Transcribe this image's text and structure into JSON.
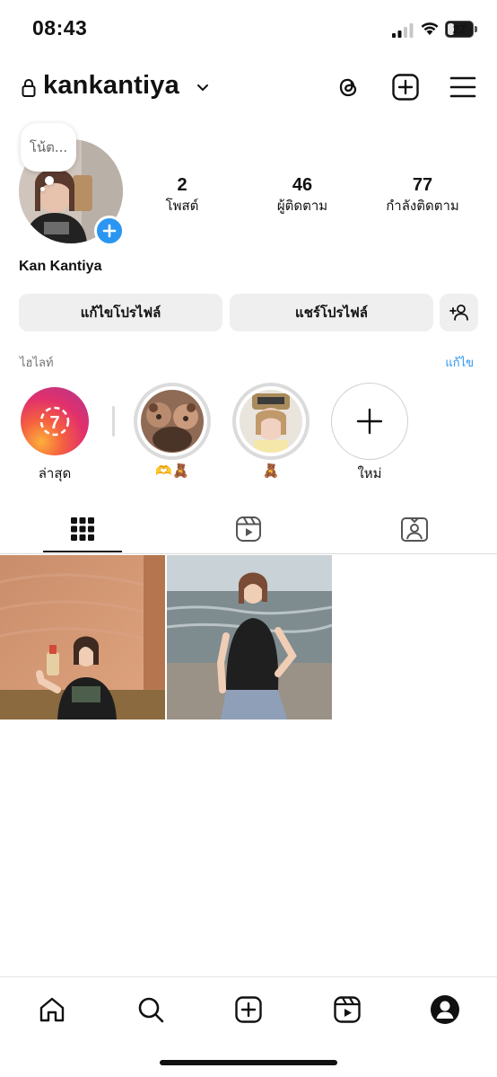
{
  "status_bar": {
    "time": "08:43",
    "battery_percent": "27",
    "battery_level": 0.27
  },
  "header": {
    "username": "kankantiya",
    "icons": [
      "lock-icon",
      "chevron-down-icon",
      "threads-icon",
      "create-post-icon",
      "menu-icon"
    ]
  },
  "profile": {
    "note_placeholder": "โน้ต...",
    "display_name": "Kan Kantiya",
    "stats": [
      {
        "value": "2",
        "label": "โพสต์"
      },
      {
        "value": "46",
        "label": "ผู้ติดตาม"
      },
      {
        "value": "77",
        "label": "กำลังติดตาม"
      }
    ],
    "edit_profile_label": "แก้ไขโปรไฟล์",
    "share_profile_label": "แชร์โปรไฟล์"
  },
  "highlights": {
    "title": "ไฮไลท์",
    "edit_label": "แก้ไข",
    "latest": {
      "count": "7",
      "label": "ล่าสุด"
    },
    "items": [
      {
        "label": "🫶🧸"
      },
      {
        "label": "🧸"
      }
    ],
    "new_label": "ใหม่"
  },
  "tabs": [
    "grid-icon",
    "reels-icon",
    "tagged-icon"
  ],
  "bottom_nav": [
    "home-icon",
    "search-icon",
    "create-icon",
    "reels-icon",
    "profile-icon"
  ],
  "colors": {
    "accent": "#2a96f1",
    "pill_bg": "#efefef",
    "muted_text": "#737373"
  }
}
